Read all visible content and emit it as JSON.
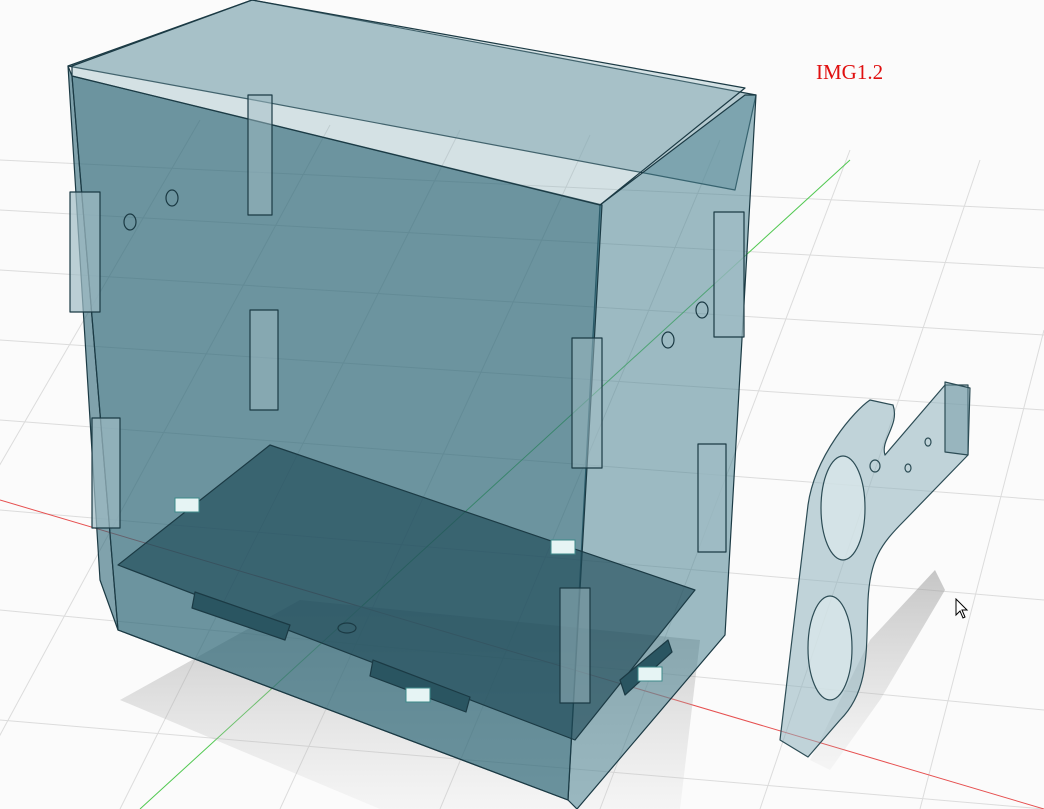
{
  "viewport": {
    "label": "IMG1.2",
    "label_color": "#e01010",
    "background": "#fbfbfb"
  },
  "scene": {
    "objects": [
      "enclosure-box",
      "bracket-part"
    ],
    "body_color": "#2f6878",
    "grid_color": "#dcdcdc",
    "axis_x_color": "#e65050",
    "axis_y_color": "#50c850",
    "joint_markers": 4,
    "cursor_icon": "arrow-cursor-icon"
  }
}
